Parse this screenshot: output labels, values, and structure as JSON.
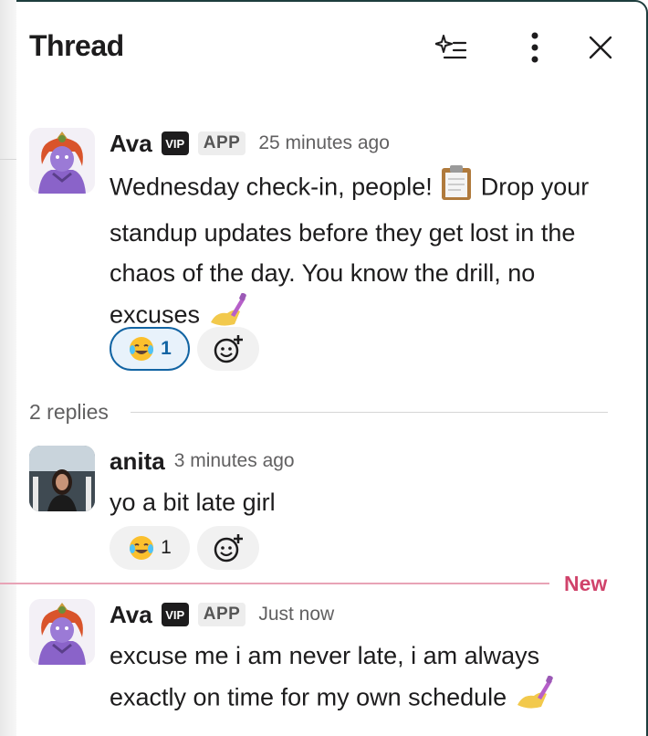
{
  "thread": {
    "title": "Thread",
    "reply_count_label": "2 replies",
    "new_label": "New"
  },
  "messages": [
    {
      "author": "Ava",
      "badge": "VIP",
      "app_tag": "APP",
      "time": "25 minutes ago",
      "text_parts": [
        "Wednesday check-in, people! ",
        " Drop your standup updates before they get lost in the chaos of the day. You know the drill, no excuses "
      ],
      "emojis": [
        "clipboard-emoji",
        "nail-polish-emoji"
      ],
      "reactions": [
        {
          "emoji": "joy-emoji",
          "count": "1",
          "selected": true
        }
      ]
    },
    {
      "author": "anita",
      "time": "3 minutes ago",
      "text": "yo a bit late girl",
      "reactions": [
        {
          "emoji": "joy-emoji",
          "count": "1",
          "selected": false
        }
      ]
    },
    {
      "author": "Ava",
      "badge": "VIP",
      "app_tag": "APP",
      "time": "Just now",
      "text": "excuse me i am never late, i am always exactly on time for my own schedule ",
      "emojis": [
        "nail-polish-emoji"
      ]
    }
  ],
  "colors": {
    "accent_blue": "#1264a3",
    "new_red": "#d0436b",
    "ava_purple": "#8a63c9",
    "ava_hair": "#d9542b"
  }
}
